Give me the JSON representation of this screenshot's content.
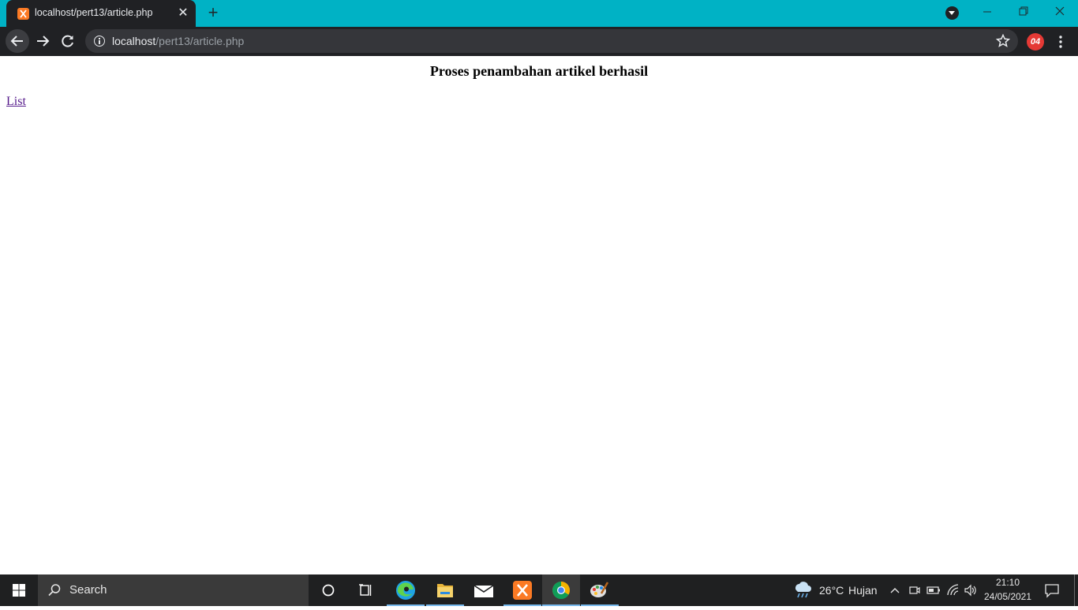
{
  "browser": {
    "tab_title": "localhost/pert13/article.php",
    "new_tab_symbol": "+",
    "url_host": "localhost",
    "url_path": "/pert13/article.php",
    "profile_badge": "04",
    "accent_color": "#00b2c5"
  },
  "page": {
    "heading": "Proses penambahan artikel berhasil",
    "link_label": "List"
  },
  "taskbar": {
    "search_placeholder": "Search",
    "weather_temp": "26°C",
    "weather_label": "Hujan",
    "clock_time": "21:10",
    "clock_date": "24/05/2021",
    "apps": [
      "cortana-icon",
      "task-view-icon",
      "edge-icon",
      "file-explorer-icon",
      "mail-icon",
      "xampp-icon",
      "chrome-icon",
      "paint-icon"
    ]
  }
}
